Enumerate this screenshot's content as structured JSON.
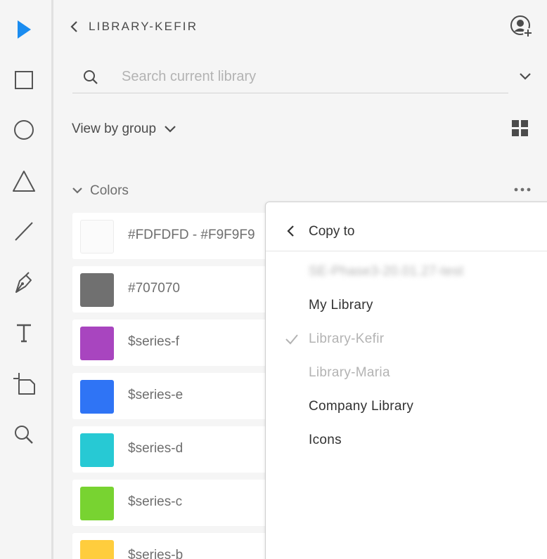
{
  "header": {
    "title": "LIBRARY-KEFIR"
  },
  "search": {
    "placeholder": "Search current library",
    "value": ""
  },
  "view": {
    "label": "View by group"
  },
  "group": {
    "label": "Colors"
  },
  "colors": [
    {
      "name": "#FDFDFD - #F9F9F9",
      "color": "#fbfbfb"
    },
    {
      "name": "#707070",
      "color": "#707070"
    },
    {
      "name": "$series-f",
      "color": "#a845bf"
    },
    {
      "name": "$series-e",
      "color": "#2f74f5"
    },
    {
      "name": "$series-d",
      "color": "#27c9d4"
    },
    {
      "name": "$series-c",
      "color": "#78d331"
    },
    {
      "name": "$series-b",
      "color": "#ffcd3d"
    }
  ],
  "dropdown": {
    "title": "Copy to",
    "items": [
      {
        "label": "SE-Phase3-20.01.27-test",
        "state": "blurred"
      },
      {
        "label": "My Library",
        "state": "enabled"
      },
      {
        "label": "Library-Kefir",
        "state": "current"
      },
      {
        "label": "Library-Maria",
        "state": "disabled"
      },
      {
        "label": "Company Library",
        "state": "enabled"
      },
      {
        "label": "Icons",
        "state": "enabled"
      }
    ]
  },
  "accent_color": "#1a8cf0"
}
